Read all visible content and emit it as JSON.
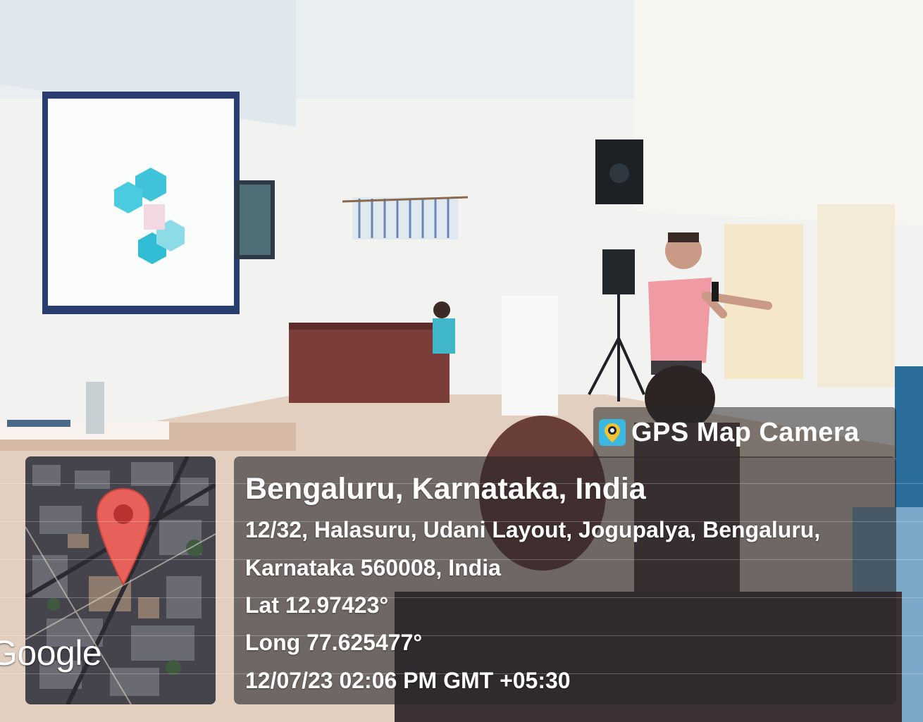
{
  "badge": {
    "app_name": "GPS Map Camera",
    "icon": "map-camera-icon"
  },
  "map": {
    "provider_logo": "Google",
    "pin_icon": "map-pin-icon"
  },
  "location": {
    "city_line": "Bengaluru, Karnataka, India",
    "address_line1": "12/32, Halasuru, Udani Layout, Jogupalya, Bengaluru,",
    "address_line2": "Karnataka 560008, India",
    "latitude": "Lat 12.97423°",
    "longitude": "Long 77.625477°",
    "timestamp": "12/07/23 02:06 PM GMT +05:30"
  },
  "colors": {
    "pin": "#e8605a",
    "badge_icon_bg": "#3bb8e0",
    "badge_icon_fg": "#f2c230"
  }
}
